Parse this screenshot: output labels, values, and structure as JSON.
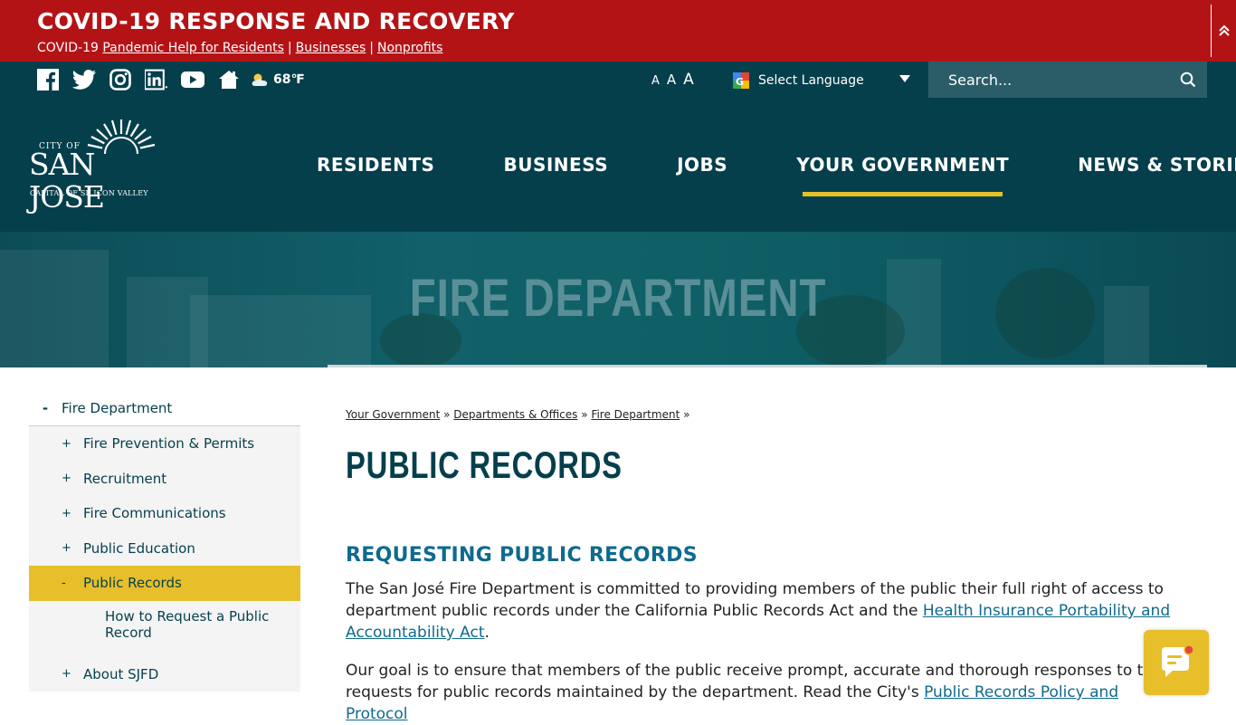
{
  "covid": {
    "title": "COVID-19 RESPONSE AND RECOVERY",
    "prefix": "COVID-19",
    "links": [
      "Pandemic Help for Residents",
      "Businesses",
      "Nonprofits"
    ],
    "separator": "|"
  },
  "utility": {
    "social_icons": [
      "facebook-icon",
      "twitter-icon",
      "instagram-icon",
      "linkedin-icon",
      "youtube-icon",
      "home-icon"
    ],
    "weather_icon": "partly-cloudy-icon",
    "temperature": "68℉",
    "font_sizes": [
      "A",
      "A",
      "A"
    ],
    "language_label": "Select Language",
    "search_placeholder": "Search..."
  },
  "logo": {
    "city_of": "CITY OF",
    "name": "SAN JOSE",
    "tagline": "CAPITAL OF SILICON VALLEY"
  },
  "nav": {
    "items": [
      "RESIDENTS",
      "BUSINESS",
      "JOBS",
      "YOUR GOVERNMENT",
      "NEWS & STORIES"
    ],
    "active": "YOUR GOVERNMENT"
  },
  "hero": {
    "title": "FIRE DEPARTMENT"
  },
  "sidebar": {
    "top": {
      "toggle": "-",
      "label": "Fire Department"
    },
    "items": [
      {
        "toggle": "+",
        "label": "Fire Prevention & Permits"
      },
      {
        "toggle": "+",
        "label": "Recruitment"
      },
      {
        "toggle": "+",
        "label": "Fire Communications"
      },
      {
        "toggle": "+",
        "label": "Public Education"
      },
      {
        "toggle": "-",
        "label": "Public Records"
      }
    ],
    "sub_item": "How to Request a Public Record",
    "last_item": {
      "toggle": "+",
      "label": "About SJFD"
    }
  },
  "breadcrumb": {
    "items": [
      "Your Government",
      "Departments & Offices",
      "Fire Department"
    ],
    "separator": "»"
  },
  "content": {
    "title": "PUBLIC RECORDS",
    "section_heading": "REQUESTING PUBLIC RECORDS",
    "p1_text": "The San José Fire Department is committed to providing members of the public their full right of access to department public records under the California Public Records Act and the ",
    "p1_link": "Health Insurance Portability and Accountability Act",
    "p1_end": ".",
    "p2_text": "Our goal is to ensure that members of the public receive prompt, accurate and thorough responses to their requests for public records maintained by the department. Read the City's ",
    "p2_link": "Public Records Policy and Protocol"
  },
  "colors": {
    "covid_red": "#b41316",
    "dark_teal": "#053f4c",
    "accent_gold": "#e6bf2a",
    "link_blue": "#0e6a8e"
  }
}
